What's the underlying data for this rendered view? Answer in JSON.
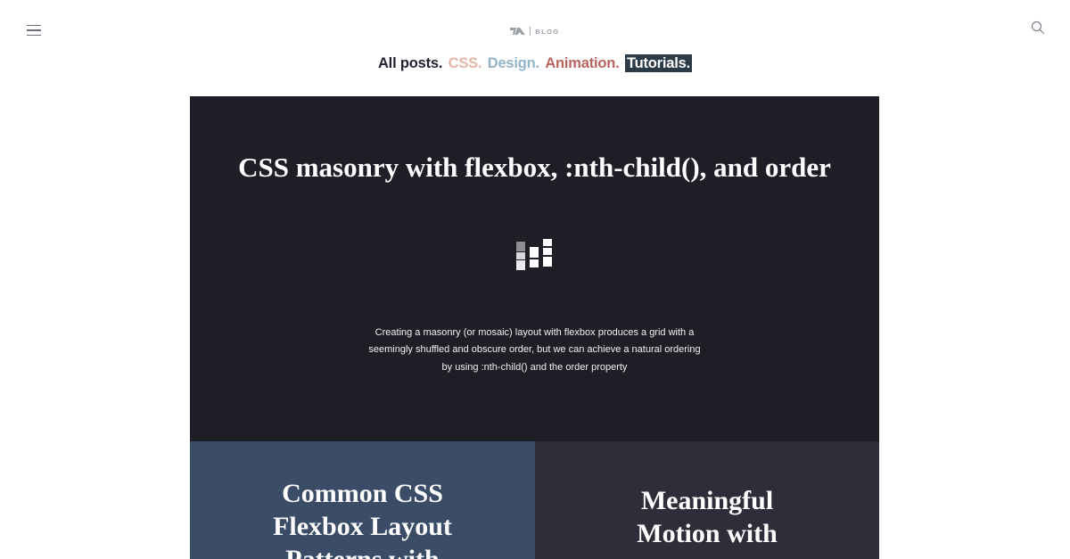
{
  "header": {
    "brand": {
      "logo_icon": "brand-logo-icon",
      "label": "BLOG"
    },
    "menu_icon": "hamburger-menu-icon",
    "search_icon": "search-icon"
  },
  "filters": {
    "all": "All posts.",
    "css": "CSS.",
    "design": "Design.",
    "animation": "Animation.",
    "tutorials": "Tutorials.",
    "active": "tutorials"
  },
  "featured_post": {
    "title": "CSS masonry with flexbox, :nth-child(), and order",
    "excerpt": "Creating a masonry (or mosaic) layout with flexbox produces a grid with a seemingly shuffled and obscure order, but we can achieve a natural ordering by using :nth-child() and the order property",
    "thumbnail_icon": "masonry-grid-icon"
  },
  "posts": [
    {
      "title": "Common CSS Flexbox Layout Patterns with",
      "bg": "#3b4c67"
    },
    {
      "title": "Meaningful Motion with",
      "bg": "#2e2e3b"
    }
  ],
  "colors": {
    "featured_bg": "#1e1e26",
    "tag_css": "#e6b5a6",
    "tag_design": "#93b3c9",
    "tag_animation": "#b9655f",
    "tag_tutorials_bg": "#2b3b48"
  }
}
